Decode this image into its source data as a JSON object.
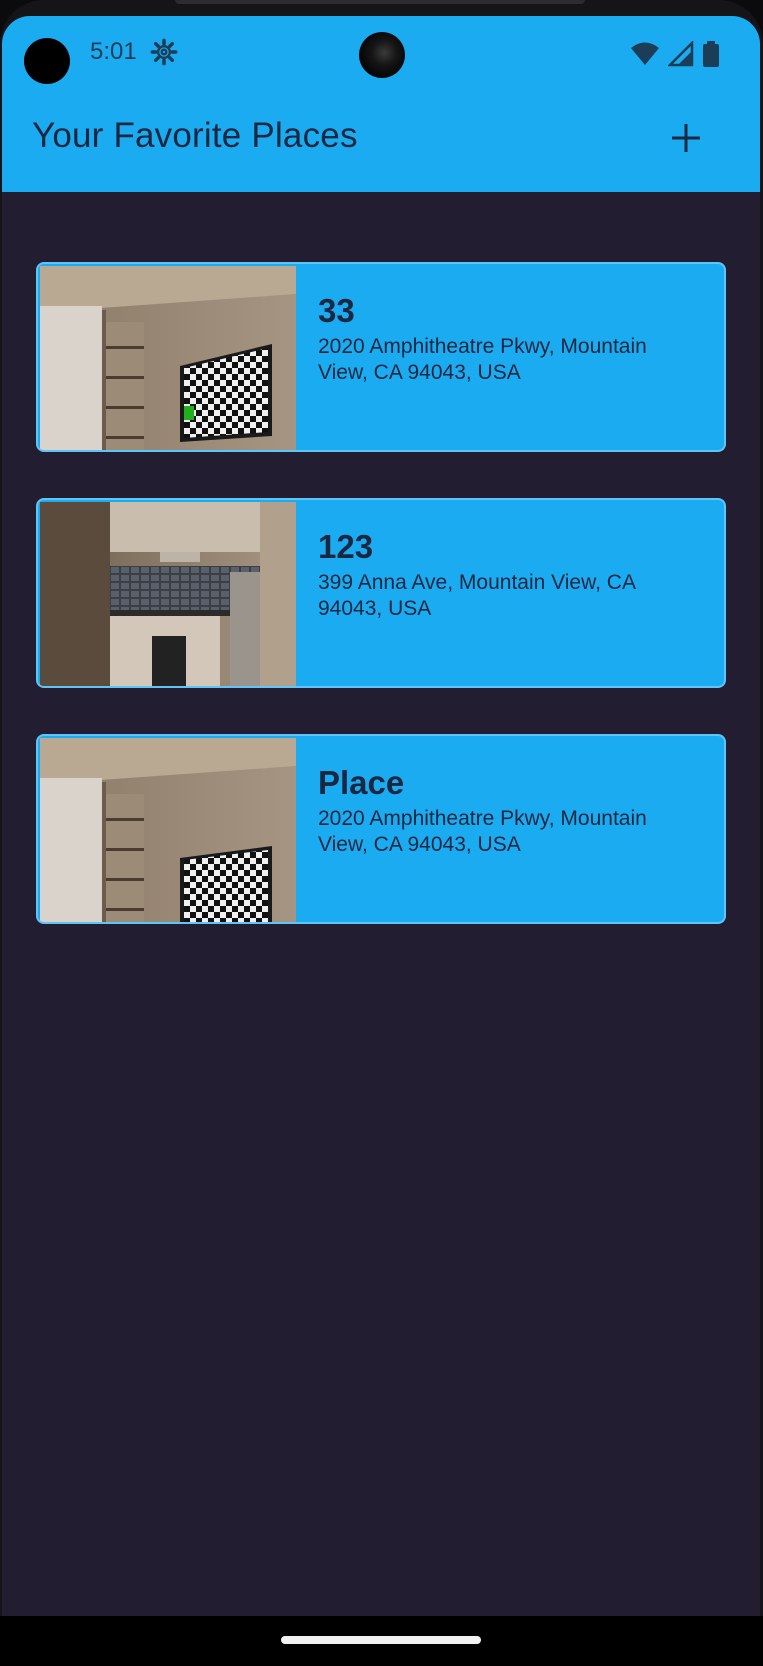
{
  "status_bar": {
    "time": "5:01",
    "icons": [
      "settings-icon",
      "wifi-icon",
      "signal-icon",
      "battery-icon"
    ]
  },
  "app_bar": {
    "title": "Your Favorite Places",
    "add_icon": "plus-icon"
  },
  "places": [
    {
      "title": "33",
      "address": "2020 Amphitheatre Pkwy, Mountain View, CA 94043, USA",
      "thumbnail": "room-with-checkerboard"
    },
    {
      "title": "123",
      "address": "399 Anna Ave, Mountain View, CA 94043, USA",
      "thumbnail": "kitchen"
    },
    {
      "title": "Place",
      "address": "2020 Amphitheatre Pkwy, Mountain View, CA 94043, USA",
      "thumbnail": "room-with-checkerboard"
    }
  ],
  "colors": {
    "app_bar": "#1aabf1",
    "background": "#221d30",
    "card": "#1aabf1",
    "card_border": "#5fc4f7",
    "text_dark": "#1a2740"
  }
}
